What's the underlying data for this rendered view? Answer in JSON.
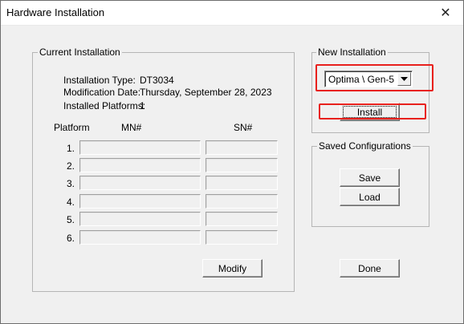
{
  "window": {
    "title": "Hardware Installation",
    "close_glyph": "✕"
  },
  "current_installation": {
    "label": "Current Installation",
    "installation_type_label": "Installation Type:",
    "installation_type_value": "DT3034",
    "modification_date_label": "Modification Date:",
    "modification_date_value": "Thursday, September 28, 2023",
    "installed_platforms_label": "Installed Platforms:",
    "installed_platforms_value": "1",
    "columns": {
      "platform": "Platform",
      "mn": "MN#",
      "sn": "SN#"
    },
    "rows": [
      {
        "num": "1.",
        "mn": "",
        "sn": ""
      },
      {
        "num": "2.",
        "mn": "",
        "sn": ""
      },
      {
        "num": "3.",
        "mn": "",
        "sn": ""
      },
      {
        "num": "4.",
        "mn": "",
        "sn": ""
      },
      {
        "num": "5.",
        "mn": "",
        "sn": ""
      },
      {
        "num": "6.",
        "mn": "",
        "sn": ""
      }
    ],
    "modify_button": "Modify"
  },
  "new_installation": {
    "label": "New Installation",
    "selected_option": "Optima \\ Gen-5",
    "install_button": "Install"
  },
  "saved_configurations": {
    "label": "Saved Configurations",
    "save_button": "Save",
    "load_button": "Load"
  },
  "done_button": "Done",
  "colors": {
    "highlight": "#e8201c",
    "dialog_bg": "#f0f0f0"
  }
}
